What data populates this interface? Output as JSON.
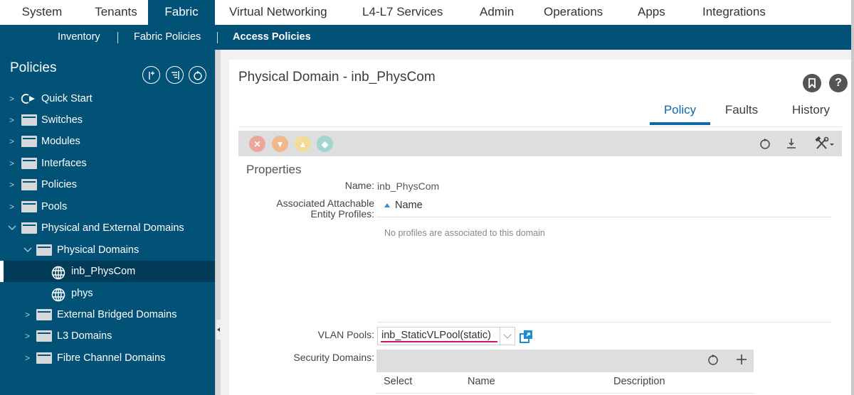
{
  "topnav": {
    "tabs": [
      {
        "label": "System",
        "active": false
      },
      {
        "label": "Tenants",
        "active": false
      },
      {
        "label": "Fabric",
        "active": true
      },
      {
        "label": "Virtual Networking",
        "active": false
      },
      {
        "label": "L4-L7 Services",
        "active": false
      },
      {
        "label": "Admin",
        "active": false
      },
      {
        "label": "Operations",
        "active": false
      },
      {
        "label": "Apps",
        "active": false
      },
      {
        "label": "Integrations",
        "active": false
      }
    ]
  },
  "subnav": {
    "items": [
      {
        "label": "Inventory",
        "active": false
      },
      {
        "label": "Fabric Policies",
        "active": false
      },
      {
        "label": "Access Policies",
        "active": true
      }
    ]
  },
  "sidebar": {
    "title": "Policies",
    "header_buttons": [
      "add-icon",
      "filter-icon",
      "refresh-icon"
    ],
    "tree": [
      {
        "label": "Quick Start",
        "icon": "quick-start-icon",
        "expanded": false,
        "level": 0
      },
      {
        "label": "Switches",
        "icon": "folder-icon",
        "expanded": false,
        "level": 0
      },
      {
        "label": "Modules",
        "icon": "folder-icon",
        "expanded": false,
        "level": 0
      },
      {
        "label": "Interfaces",
        "icon": "folder-icon",
        "expanded": false,
        "level": 0
      },
      {
        "label": "Policies",
        "icon": "folder-icon",
        "expanded": false,
        "level": 0
      },
      {
        "label": "Pools",
        "icon": "folder-icon",
        "expanded": false,
        "level": 0
      },
      {
        "label": "Physical and External Domains",
        "icon": "folder-icon",
        "expanded": true,
        "level": 0
      },
      {
        "label": "Physical Domains",
        "icon": "folder-icon",
        "expanded": true,
        "level": 1
      },
      {
        "label": "inb_PhysCom",
        "icon": "globe-icon",
        "selected": true,
        "level": 2
      },
      {
        "label": "phys",
        "icon": "globe-icon",
        "level": 2
      },
      {
        "label": "External Bridged Domains",
        "icon": "folder-icon",
        "expanded": false,
        "level": 1
      },
      {
        "label": "L3 Domains",
        "icon": "folder-icon",
        "expanded": false,
        "level": 1
      },
      {
        "label": "Fibre Channel Domains",
        "icon": "folder-icon",
        "expanded": false,
        "level": 1
      }
    ]
  },
  "main": {
    "title": "Physical Domain - inb_PhysCom",
    "tabs": [
      {
        "label": "Policy",
        "active": true
      },
      {
        "label": "Faults",
        "active": false
      },
      {
        "label": "History",
        "active": false
      }
    ],
    "fault_colors": {
      "critical": "#eba79a",
      "major": "#f2b78c",
      "minor": "#f3dc99",
      "warning": "#9fd7cf"
    },
    "section_title": "Properties",
    "name_label": "Name:",
    "name_value": "inb_PhysCom",
    "aep_label_line1": "Associated Attachable",
    "aep_label_line2": "Entity Profiles:",
    "aep_column": "Name",
    "aep_empty": "No profiles are associated to this domain",
    "vlan_label": "VLAN Pools:",
    "vlan_value": "inb_StaticVLPool(static)",
    "security_label": "Security Domains:",
    "security_columns": [
      "Select",
      "Name",
      "Description"
    ]
  },
  "colors": {
    "brand": "#025177",
    "accent": "#0b6ba8",
    "highlight": "#d3136b"
  }
}
